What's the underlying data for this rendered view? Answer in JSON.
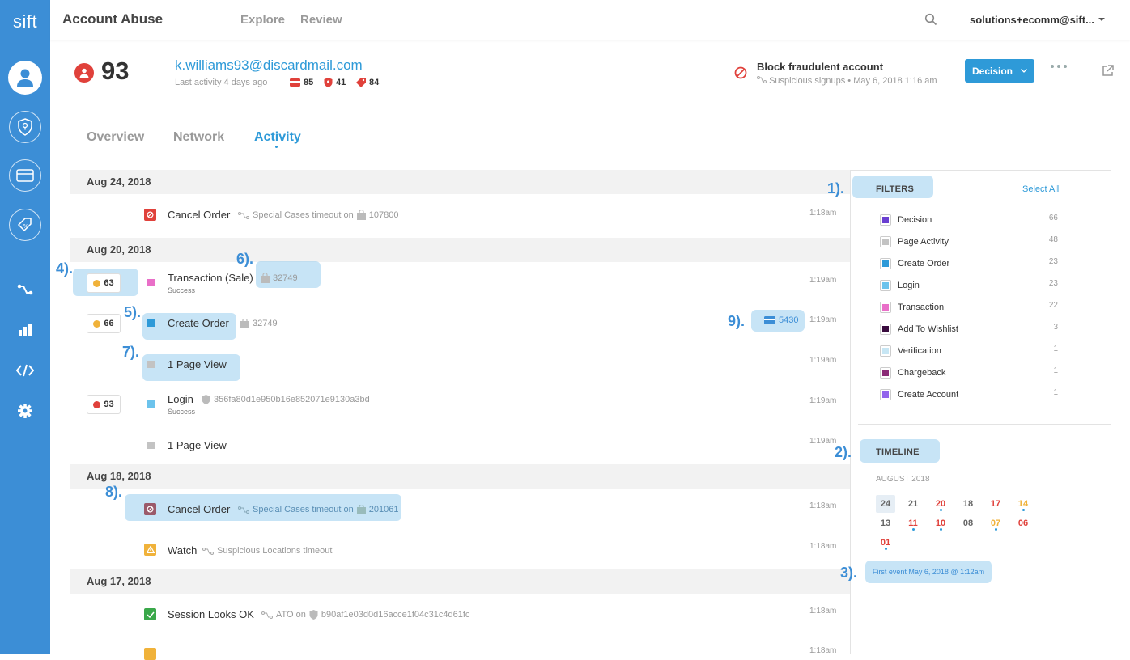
{
  "app": {
    "logo": "sift",
    "title": "Account Abuse"
  },
  "topnav": {
    "items": [
      "Explore",
      "Review"
    ],
    "account": "solutions+ecomm@sift..."
  },
  "header": {
    "score": "93",
    "email": "k.williams93@discardmail.com",
    "last_activity": "Last activity 4 days ago",
    "stats": [
      {
        "icon": "card-icon",
        "value": "85"
      },
      {
        "icon": "shield-icon",
        "value": "41"
      },
      {
        "icon": "tag-icon",
        "value": "84"
      }
    ],
    "decision_title": "Block fraudulent account",
    "decision_sub": "Suspicious signups • May 6, 2018 1:16 am",
    "decision_button": "Decision"
  },
  "tabs": [
    "Overview",
    "Network",
    "Activity"
  ],
  "activity": {
    "dates": [
      "Aug 24, 2018",
      "Aug 20, 2018",
      "Aug 18, 2018",
      "Aug 17, 2018"
    ],
    "events": [
      {
        "title": "Cancel Order",
        "meta": "Special Cases timeout on",
        "ref": "107800",
        "time": "1:18am"
      },
      {
        "title": "Transaction (Sale)",
        "sub": "Success",
        "ref": "32749",
        "time": "1:19am",
        "score": "63"
      },
      {
        "title": "Create Order",
        "ref": "32749",
        "card": "5430",
        "time": "1:19am",
        "score": "66"
      },
      {
        "title": "1 Page View",
        "time": "1:19am"
      },
      {
        "title": "Login",
        "sub": "Success",
        "ref": "356fa80d1e950b16e852071e9130a3bd",
        "time": "1:19am",
        "score": "93"
      },
      {
        "title": "1 Page View",
        "time": "1:19am"
      },
      {
        "title": "Cancel Order",
        "meta": "Special Cases timeout on",
        "ref": "201061",
        "time": "1:18am"
      },
      {
        "title": "Watch",
        "meta": "Suspicious Locations timeout",
        "time": "1:18am"
      },
      {
        "title": "Session Looks OK",
        "meta": "ATO on",
        "ref": "b90af1e03d0d16acce1f04c31c4d61fc",
        "time": "1:18am"
      },
      {
        "title": "",
        "time": "1:18am"
      }
    ]
  },
  "annotations": [
    "1).",
    "2).",
    "3).",
    "4).",
    "5).",
    "6).",
    "7).",
    "8).",
    "9)."
  ],
  "filters": {
    "title": "FILTERS",
    "select_all": "Select All",
    "items": [
      {
        "label": "Decision",
        "count": "66",
        "color": "#6a3fd1"
      },
      {
        "label": "Page Activity",
        "count": "48",
        "color": "#c3c3c3"
      },
      {
        "label": "Create Order",
        "count": "23",
        "color": "#2e9ad8"
      },
      {
        "label": "Login",
        "count": "23",
        "color": "#6cc3ec"
      },
      {
        "label": "Transaction",
        "count": "22",
        "color": "#e96fc8"
      },
      {
        "label": "Add To Wishlist",
        "count": "3",
        "color": "#3a0c3e"
      },
      {
        "label": "Verification",
        "count": "1",
        "color": "#c7e6f4"
      },
      {
        "label": "Chargeback",
        "count": "1",
        "color": "#8b2b77"
      },
      {
        "label": "Create Account",
        "count": "1",
        "color": "#9264ec"
      }
    ]
  },
  "timeline": {
    "title": "TIMELINE",
    "month": "AUGUST 2018",
    "days": [
      {
        "d": "24",
        "color": "#666",
        "sel": true
      },
      {
        "d": "21",
        "color": "#666"
      },
      {
        "d": "20",
        "color": "#e0413b",
        "dot": true
      },
      {
        "d": "18",
        "color": "#666"
      },
      {
        "d": "17",
        "color": "#e0413b"
      },
      {
        "d": "14",
        "color": "#f0b23a",
        "dot": true
      },
      {
        "d": "13",
        "color": "#666"
      },
      {
        "d": "11",
        "color": "#e0413b",
        "dot": true
      },
      {
        "d": "10",
        "color": "#e0413b",
        "dot": true
      },
      {
        "d": "08",
        "color": "#666"
      },
      {
        "d": "07",
        "color": "#f0b23a",
        "dot": true
      },
      {
        "d": "06",
        "color": "#e0413b"
      },
      {
        "d": "01",
        "color": "#e0413b",
        "dot": true
      }
    ],
    "first_event": "First event May 6, 2018 @ 1:12am"
  }
}
